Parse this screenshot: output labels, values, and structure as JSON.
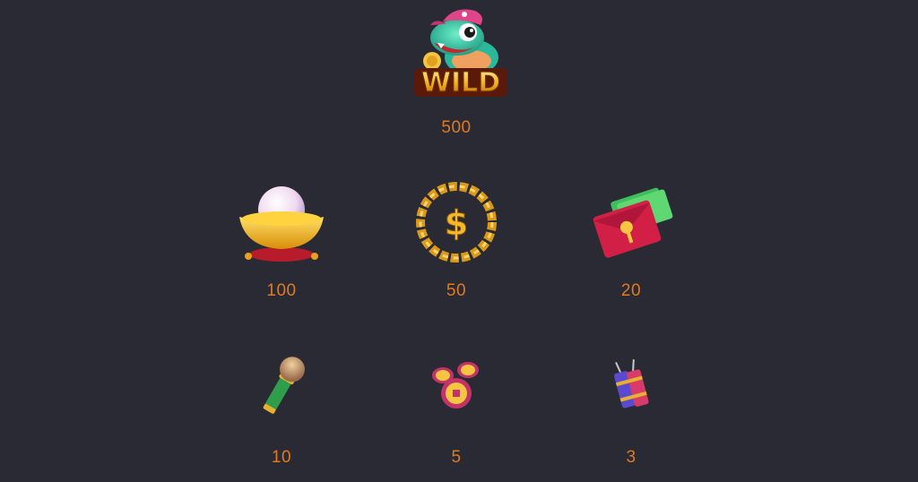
{
  "paytable": {
    "symbols": [
      {
        "name": "wild",
        "value": "500",
        "logo_text": "WILD"
      },
      {
        "name": "gold-ingot",
        "value": "100"
      },
      {
        "name": "dollar-medallion",
        "value": "50"
      },
      {
        "name": "red-envelope",
        "value": "20"
      },
      {
        "name": "microphone",
        "value": "10"
      },
      {
        "name": "coins",
        "value": "5"
      },
      {
        "name": "firecracker",
        "value": "3"
      }
    ]
  },
  "colors": {
    "background": "#2a2a35",
    "value_text": "#e07a1f"
  }
}
